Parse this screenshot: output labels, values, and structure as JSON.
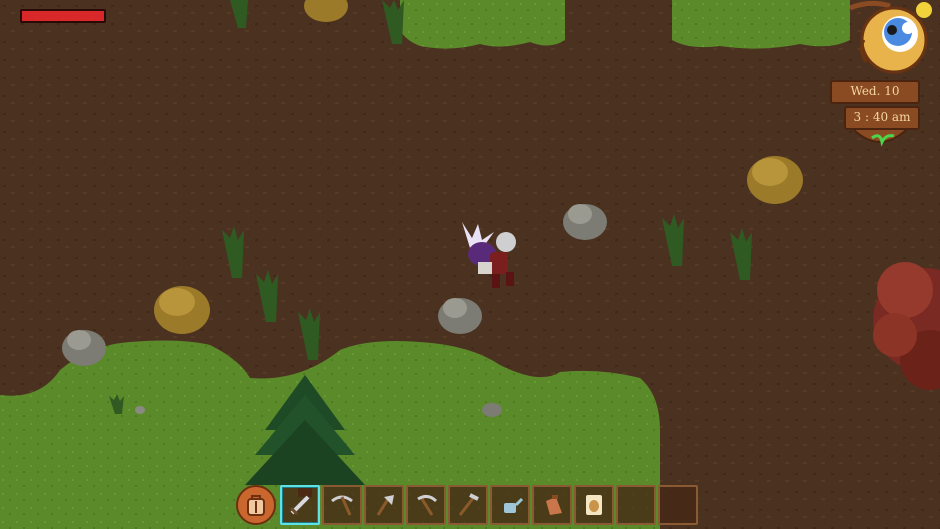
{
  "hud": {
    "health_fraction": 1.0,
    "health_color": "#d8282a",
    "day": "Wed. 10",
    "time": "3 : 40 am"
  },
  "hotbar": {
    "selected_index": 0,
    "slots": [
      {
        "icon": "sword-icon"
      },
      {
        "icon": "pickaxe-icon"
      },
      {
        "icon": "axe-icon"
      },
      {
        "icon": "scythe-icon"
      },
      {
        "icon": "hoe-icon"
      },
      {
        "icon": "watering-can-icon"
      },
      {
        "icon": "seed-bag-icon"
      },
      {
        "icon": "seed-packet-icon"
      },
      {
        "icon": "empty"
      },
      {
        "icon": "empty"
      }
    ]
  },
  "colors": {
    "dirt": "#4a3120",
    "grass": "#5f8a2c",
    "accent": "#5fe1e6"
  }
}
